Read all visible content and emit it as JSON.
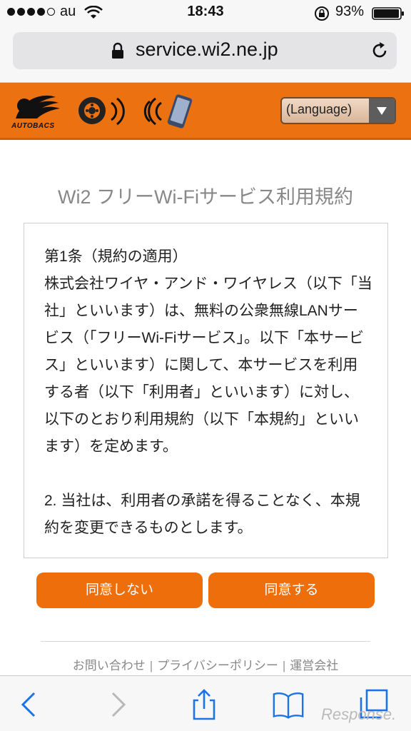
{
  "status_bar": {
    "carrier": "au",
    "time": "18:43",
    "battery": "93%"
  },
  "address_bar": {
    "url": "service.wi2.ne.jp"
  },
  "site_header": {
    "logo_text": "AUTOBACS",
    "language_label": "(Language)",
    "brand_color": "#ec7110"
  },
  "page": {
    "title": "Wi2 フリーWi-Fiサービス利用規約",
    "terms_text": "第1条（規約の適用）\n株式会社ワイヤ・アンド・ワイヤレス（以下「当社」といいます）は、無料の公衆無線LANサービス（「フリーWi-Fiサービス」。以下「本サービス」といいます）に関して、本サービスを利用する者（以下「利用者」といいます）に対し、以下のとおり利用規約（以下「本規約」といいます）を定めます。\n\n2. 当社は、利用者の承諾を得ることなく、本規約を変更できるものとします。"
  },
  "buttons": {
    "disagree": "同意しない",
    "agree": "同意する"
  },
  "footer": {
    "links": [
      "お問い合わせ",
      "プライバシーポリシー",
      "運営会社"
    ],
    "separator": "|"
  },
  "watermark": "Response."
}
